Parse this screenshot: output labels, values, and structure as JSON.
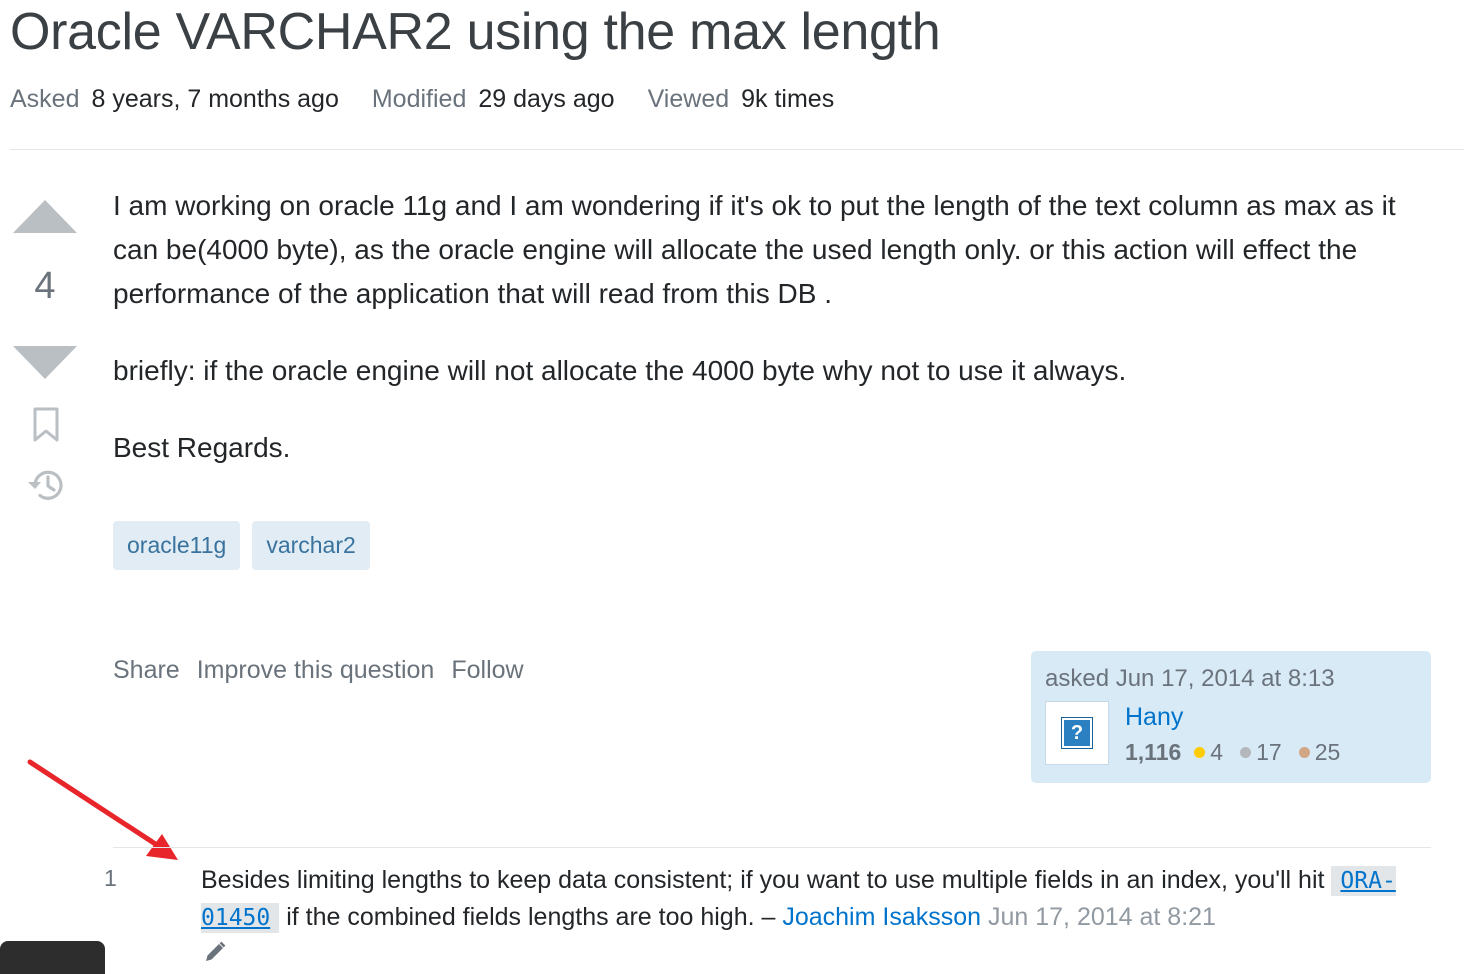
{
  "question": {
    "title": "Oracle VARCHAR2 using the max length",
    "meta": {
      "asked_label": "Asked",
      "asked_value": "8 years, 7 months ago",
      "modified_label": "Modified",
      "modified_value": "29 days ago",
      "viewed_label": "Viewed",
      "viewed_value": "9k times"
    },
    "vote_count": "4",
    "body": [
      "I am working on oracle 11g and I am wondering if it's ok to put the length of the text column as max as it can be(4000 byte), as the oracle engine will allocate the used length only. or this action will effect the performance of the application that will read from this DB .",
      "briefly: if the oracle engine will not allocate the 4000 byte why not to use it always.",
      "Best Regards."
    ],
    "tags": [
      "oracle11g",
      "varchar2"
    ],
    "menu": {
      "share": "Share",
      "improve": "Improve this question",
      "follow": "Follow"
    },
    "owner": {
      "asked_text": "asked Jun 17, 2014 at 8:13",
      "avatar_glyph": "?",
      "name": "Hany",
      "reputation": "1,116",
      "gold": "4",
      "silver": "17",
      "bronze": "25",
      "gold_color": "#ffcc01",
      "silver_color": "#b4b8bc",
      "bronze_color": "#d1a684"
    }
  },
  "comment": {
    "score": "1",
    "text_before": "Besides limiting lengths to keep data consistent; if you want to use multiple fields in an index, you'll hit ",
    "code": "ORA-01450",
    "text_after": " if the combined fields lengths are too high. – ",
    "user": "Joachim Isaksson",
    "date": " Jun 17, 2014 at 8:21"
  },
  "colors": {
    "link": "#0074cc",
    "tag_bg": "#e1ecf4",
    "owner_card_bg": "#d9eaf7",
    "arrow": "#e8252a"
  },
  "icons": [
    "vote-up-icon",
    "vote-down-icon",
    "bookmark-icon",
    "history-icon",
    "pencil-icon",
    "arrow-annotation"
  ]
}
